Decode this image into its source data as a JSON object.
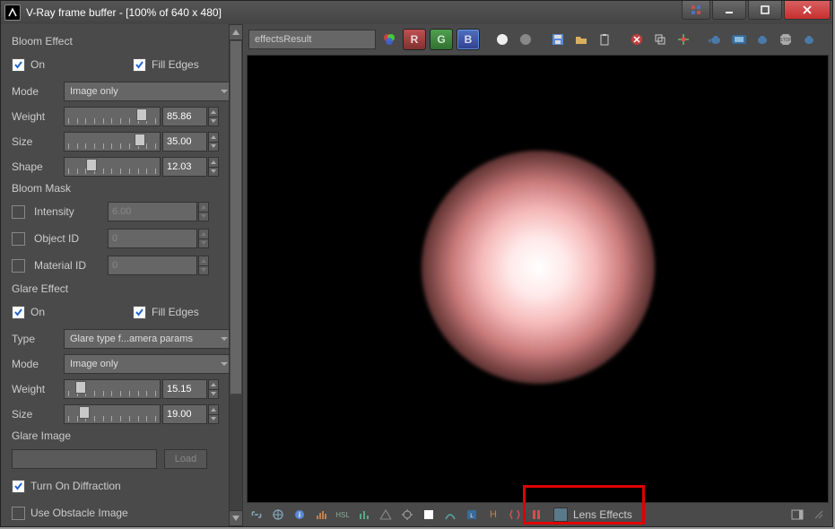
{
  "window": {
    "title": "V-Ray frame buffer - [100% of 640 x 480]"
  },
  "toolbar": {
    "channel_dropdown": "effectsResult",
    "r": "R",
    "g": "G",
    "b": "B"
  },
  "bloom": {
    "title": "Bloom Effect",
    "on_label": "On",
    "fill_edges_label": "Fill Edges",
    "mode_label": "Mode",
    "mode_value": "Image only",
    "weight_label": "Weight",
    "weight_value": "85.86",
    "size_label": "Size",
    "size_value": "35.00",
    "shape_label": "Shape",
    "shape_value": "12.03"
  },
  "bloom_mask": {
    "title": "Bloom Mask",
    "intensity_label": "Intensity",
    "intensity_value": "6.00",
    "objectid_label": "Object ID",
    "objectid_value": "0",
    "materialid_label": "Material ID",
    "materialid_value": "0"
  },
  "glare": {
    "title": "Glare Effect",
    "on_label": "On",
    "fill_edges_label": "Fill Edges",
    "type_label": "Type",
    "type_value": "Glare type f...amera params",
    "mode_label": "Mode",
    "mode_value": "Image only",
    "weight_label": "Weight",
    "weight_value": "15.15",
    "size_label": "Size",
    "size_value": "19.00"
  },
  "glare_image": {
    "title": "Glare Image",
    "load_label": "Load",
    "diffraction_label": "Turn On Diffraction",
    "obstacle_label": "Use Obstacle Image"
  },
  "bottom": {
    "lens_effects": "Lens Effects"
  }
}
